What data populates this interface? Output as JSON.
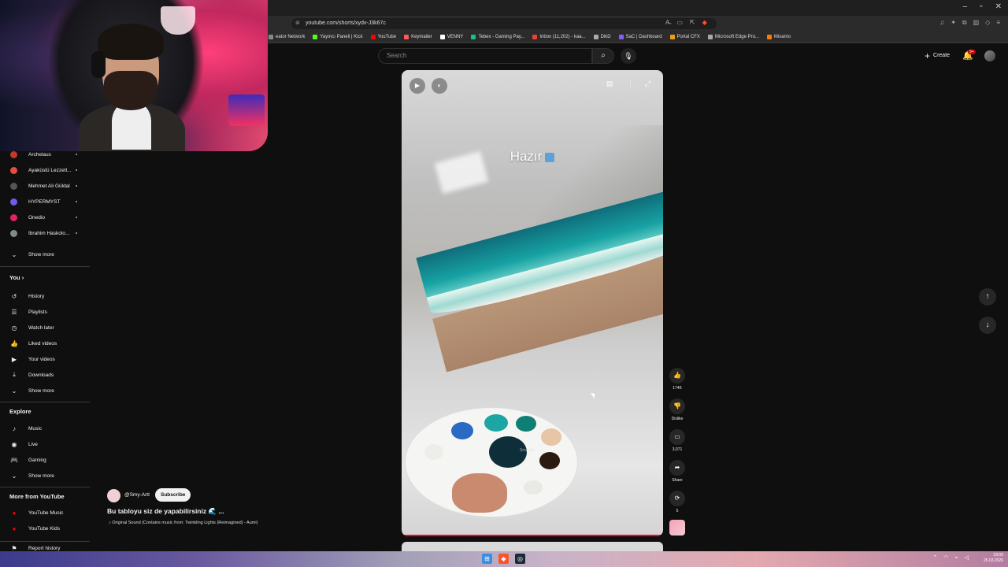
{
  "browser": {
    "url": "youtube.com/shorts/xydv-J3k67c",
    "window_controls": [
      "–",
      "▫",
      "✕"
    ],
    "bookmarks": [
      {
        "label": "eator Network",
        "color": "#888888"
      },
      {
        "label": "Yayıncı Paneli | Kick",
        "color": "#53fc18"
      },
      {
        "label": "YouTube",
        "color": "#ff0000"
      },
      {
        "label": "Keymailer",
        "color": "#ff5a5a"
      },
      {
        "label": "VENNY",
        "color": "#ffffff"
      },
      {
        "label": "Tebex - Gaming Pay...",
        "color": "#19c37d"
      },
      {
        "label": "Inbox (11,202) - kaa...",
        "color": "#ea4335"
      },
      {
        "label": "DikD",
        "color": "#aaaaaa"
      },
      {
        "label": "SaC | Dashboard",
        "color": "#8a5cf6"
      },
      {
        "label": "Portal CFX",
        "color": "#f39c12"
      },
      {
        "label": "Microsoft Edge Pro...",
        "color": "#aaaaaa"
      },
      {
        "label": "Mixamo",
        "color": "#ff7b00"
      }
    ]
  },
  "header": {
    "search_placeholder": "Search",
    "create_label": "Create",
    "notification_badge": "9+"
  },
  "sidebar": {
    "subscriptions": [
      {
        "name": "Archelaus",
        "color": "#c0392b"
      },
      {
        "name": "Ayaküstü Lezzetl...",
        "color": "#e74c3c"
      },
      {
        "name": "Mehmet Ali Güldal",
        "color": "#555555"
      },
      {
        "name": "HYPERMYST",
        "color": "#6c5ce7"
      },
      {
        "name": "Onedio",
        "color": "#e0245e"
      },
      {
        "name": "İbrahim Haskolo...",
        "color": "#7f8c8d"
      }
    ],
    "show_more": "Show more",
    "you_title": "You",
    "you_items": [
      {
        "label": "History",
        "icon": "↺"
      },
      {
        "label": "Playlists",
        "icon": "☰"
      },
      {
        "label": "Watch later",
        "icon": "◷"
      },
      {
        "label": "Liked videos",
        "icon": "👍"
      },
      {
        "label": "Your videos",
        "icon": "▶"
      },
      {
        "label": "Downloads",
        "icon": "⤓"
      }
    ],
    "you_show_more": "Show more",
    "explore_title": "Explore",
    "explore_items": [
      {
        "label": "Music",
        "icon": "♪"
      },
      {
        "label": "Live",
        "icon": "◉"
      },
      {
        "label": "Gaming",
        "icon": "🎮"
      }
    ],
    "explore_show_more": "Show more",
    "more_title": "More from YouTube",
    "more_items": [
      {
        "label": "YouTube Music",
        "color": "#ff0000"
      },
      {
        "label": "YouTube Kids",
        "color": "#ff0000"
      }
    ],
    "report_history": "Report history"
  },
  "video": {
    "caption": "Hazır",
    "watermark": "Smy.artt",
    "channel": "@Smy-Artt",
    "subscribe_label": "Subscribe",
    "title": "Bu tabloyu siz de yapabilirsiniz 🌊 ...",
    "sound": "♪ Original Sound (Contains music from: Twinkling Lights (Reimagined) - Aumi)"
  },
  "actions": {
    "like_count": "174K",
    "dislike_label": "Dislike",
    "comment_count": "3,071",
    "share_label": "Share",
    "remix_count": "5"
  },
  "taskbar": {
    "time": "23:00",
    "date": "25.03.2026"
  }
}
